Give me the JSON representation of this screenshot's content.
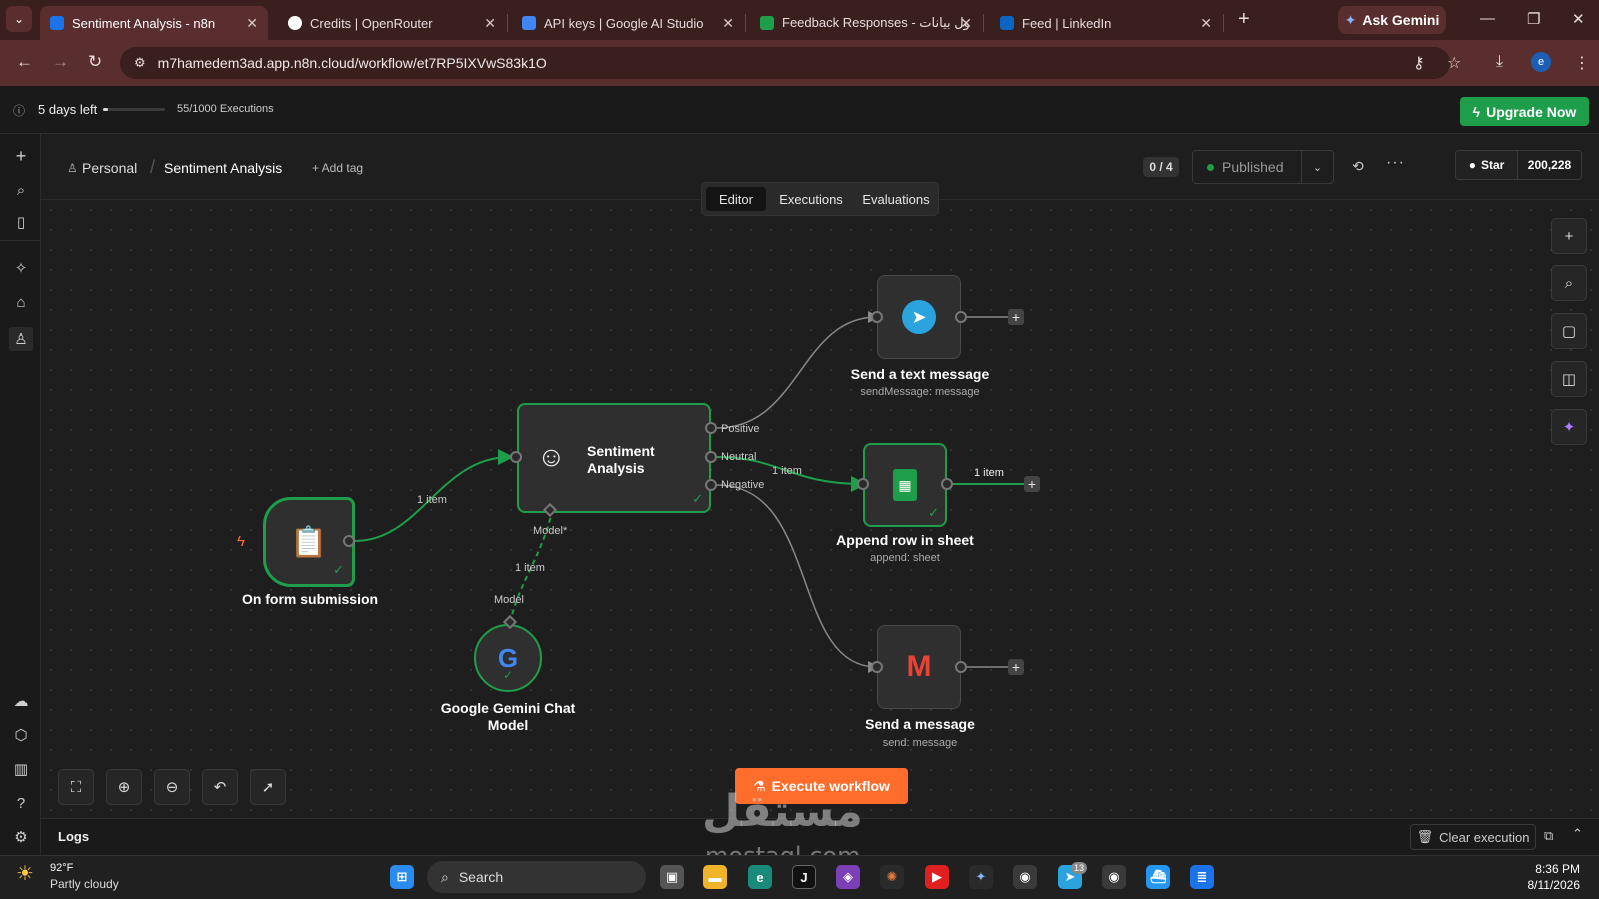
{
  "browser": {
    "tabs": [
      {
        "title": "Sentiment Analysis - n8n",
        "active": true,
        "color": "#1a73e8"
      },
      {
        "title": "Credits | OpenRouter",
        "active": false,
        "color": "#ffffff"
      },
      {
        "title": "API keys | Google AI Studio",
        "active": false,
        "color": "#4285f4"
      },
      {
        "title": "Feedback Responses - ول بيانات",
        "active": false,
        "color": "#1e9e4a"
      },
      {
        "title": "Feed | LinkedIn",
        "active": false,
        "color": "#0a66c2"
      }
    ],
    "ask_gemini": "Ask Gemini",
    "url": "m7hamedem3ad.app.n8n.cloud/workflow/et7RP5IXVwS83k1O",
    "profile_initial": "e"
  },
  "trial": {
    "days_left": "5 days left",
    "executions": "55/1000 Executions",
    "progress": 0.055,
    "upgrade_label": "Upgrade Now"
  },
  "header": {
    "project": "Personal",
    "workflow_name": "Sentiment Analysis",
    "add_tag": "+ Add tag",
    "counter": "0 / 4",
    "status": "Published",
    "github_star": "Star",
    "github_count": "200,228"
  },
  "view_tabs": [
    "Editor",
    "Executions",
    "Evaluations"
  ],
  "nodes": {
    "form": {
      "label": "On form submission"
    },
    "sentiment": {
      "label": "Sentiment Analysis",
      "outputs": [
        "Positive",
        "Neutral",
        "Negative"
      ],
      "model_port": "Model*"
    },
    "gemini": {
      "label": "Google Gemini Chat Model",
      "port": "Model"
    },
    "telegram": {
      "label": "Send a text message",
      "sub": "sendMessage: message"
    },
    "sheets": {
      "label": "Append row in sheet",
      "sub": "append: sheet"
    },
    "gmail": {
      "label": "Send a message",
      "sub": "send: message"
    }
  },
  "edges": {
    "form_to_sentiment": "1 item",
    "gemini_to_sentiment": "1 item",
    "neutral_to_sheets": "1 item",
    "sheets_out": "1 item"
  },
  "execute_label": "Execute workflow",
  "logs": {
    "label": "Logs",
    "clear": "Clear execution"
  },
  "taskbar": {
    "weather_temp": "92°F",
    "weather_cond": "Partly cloudy",
    "search": "Search",
    "time": "8:36 PM",
    "date": "8/11/2026",
    "telegram_badge": "13"
  },
  "watermark": {
    "arabic": "مستقل",
    "latin": "mostaql.com"
  },
  "colors": {
    "accent_green": "#1e9e4a",
    "execute_orange": "#ff6d2d",
    "chrome_red": "#5a2e2e"
  }
}
